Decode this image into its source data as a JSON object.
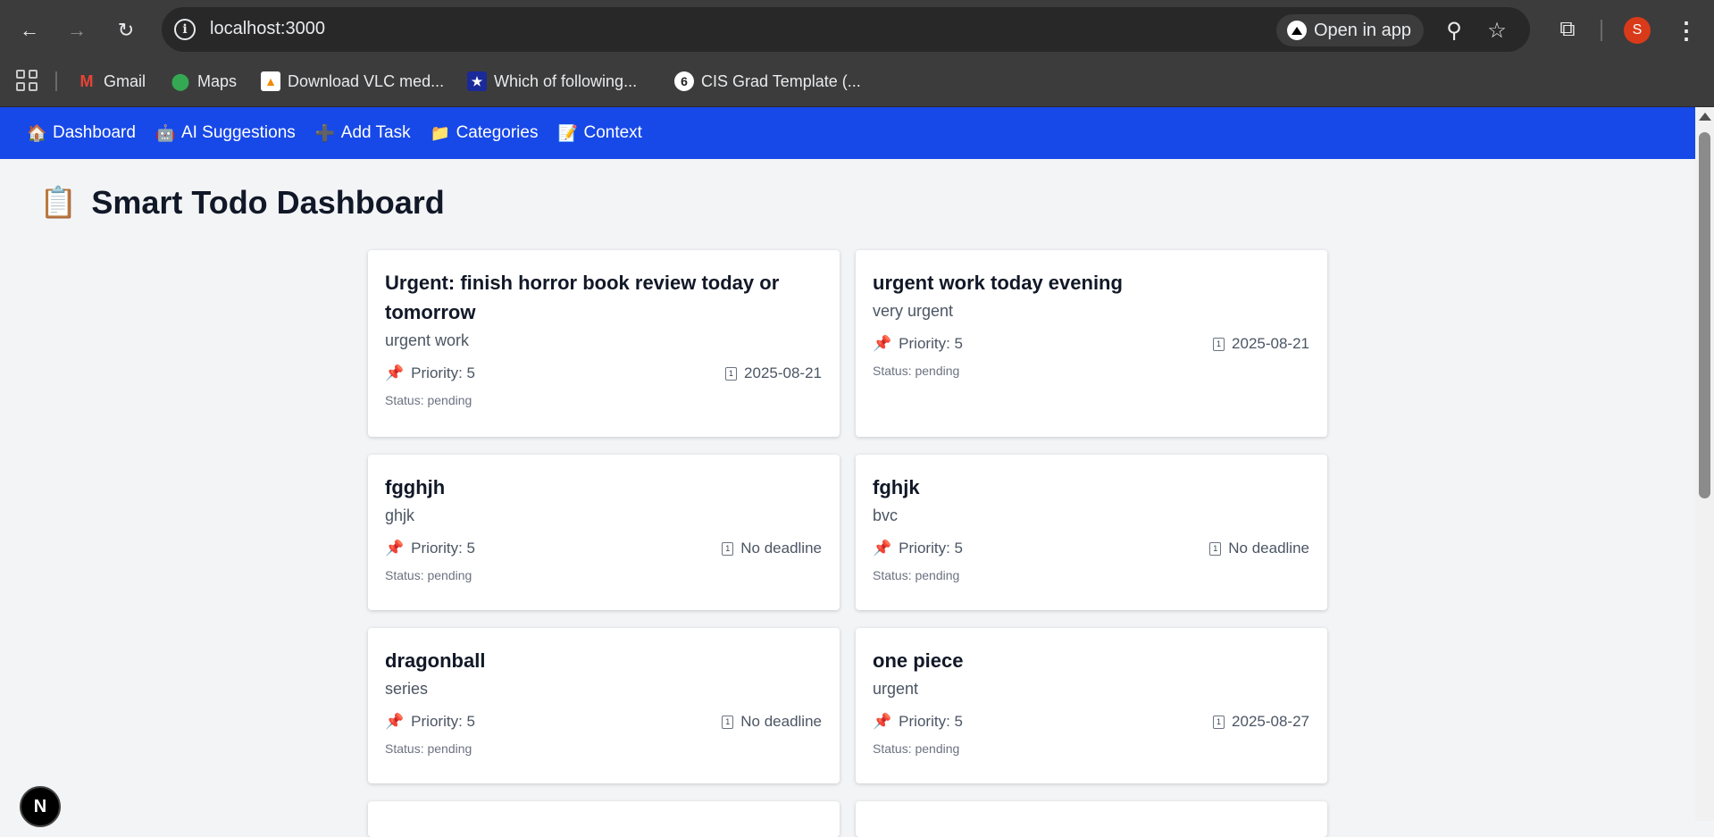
{
  "browser": {
    "url": "localhost:3000",
    "open_in_app": "Open in app",
    "profile_initial": "S",
    "bookmarks": [
      {
        "label": "Gmail",
        "icon": "gmail-icon"
      },
      {
        "label": "Maps",
        "icon": "maps-icon"
      },
      {
        "label": "Download VLC med...",
        "icon": "vlc-icon"
      },
      {
        "label": "Which of following...",
        "icon": "star-flag-icon"
      },
      {
        "label": "CIS Grad Template (...",
        "icon": "six-icon"
      }
    ]
  },
  "nav": {
    "items": [
      {
        "emoji": "🏠",
        "label": "Dashboard"
      },
      {
        "emoji": "🤖",
        "label": "AI Suggestions"
      },
      {
        "emoji": "➕",
        "label": "Add Task"
      },
      {
        "emoji": "📁",
        "label": "Categories"
      },
      {
        "emoji": "📝",
        "label": "Context"
      }
    ]
  },
  "page": {
    "title_emoji": "📋",
    "title": "Smart Todo Dashboard"
  },
  "tasks": [
    {
      "title": "Urgent: finish horror book review today or tomorrow",
      "description": "urgent work",
      "priority": "Priority: 5",
      "deadline": "2025-08-21",
      "status": "Status: pending"
    },
    {
      "title": "urgent work today evening",
      "description": "very urgent",
      "priority": "Priority: 5",
      "deadline": "2025-08-21",
      "status": "Status: pending"
    },
    {
      "title": "fgghjh",
      "description": "ghjk",
      "priority": "Priority: 5",
      "deadline": "No deadline",
      "status": "Status: pending"
    },
    {
      "title": "fghjk",
      "description": "bvc",
      "priority": "Priority: 5",
      "deadline": "No deadline",
      "status": "Status: pending"
    },
    {
      "title": "dragonball",
      "description": "series",
      "priority": "Priority: 5",
      "deadline": "No deadline",
      "status": "Status: pending"
    },
    {
      "title": "one piece",
      "description": "urgent",
      "priority": "Priority: 5",
      "deadline": "2025-08-27",
      "status": "Status: pending"
    }
  ],
  "icons": {
    "pin": "📌",
    "calendar": "1"
  },
  "colors": {
    "nav_bg": "#1748e8",
    "page_bg": "#f3f4f6",
    "pin": "#e0245e"
  },
  "nextjs_badge": "N"
}
